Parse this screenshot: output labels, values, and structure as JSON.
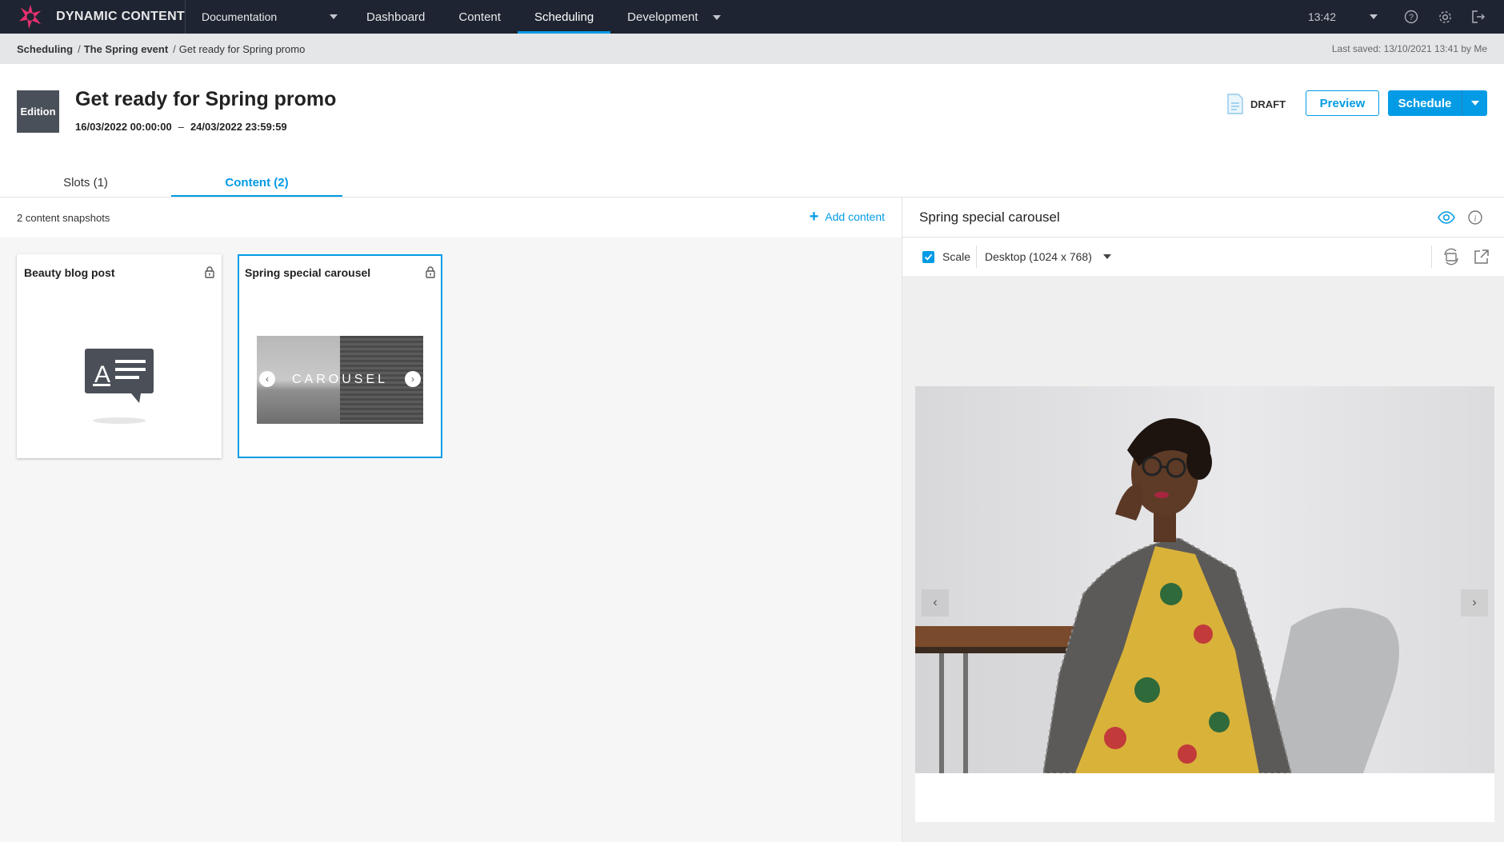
{
  "app": {
    "brand": "DYNAMIC CONTENT",
    "hub": "Documentation",
    "nav": [
      {
        "label": "Dashboard"
      },
      {
        "label": "Content"
      },
      {
        "label": "Scheduling",
        "active": true
      },
      {
        "label": "Development"
      }
    ],
    "clock": "13:42",
    "accent_color": "#039be5",
    "topbar_color": "#1e2431",
    "icons": [
      "help-icon",
      "settings-icon",
      "logout-icon"
    ]
  },
  "breadcrumb": {
    "items": [
      "Scheduling",
      "The Spring event",
      "Get ready for Spring promo"
    ],
    "last_saved": "Last saved: 13/10/2021 13:41 by Me"
  },
  "edition": {
    "badge": "Edition",
    "title": "Get ready for Spring promo",
    "start": "16/03/2022 00:00:00",
    "separator": "–",
    "end": "24/03/2022 23:59:59",
    "status": "DRAFT",
    "preview_label": "Preview",
    "schedule_label": "Schedule"
  },
  "tabs": [
    {
      "label": "Slots (1)",
      "active": false
    },
    {
      "label": "Content (2)",
      "active": true
    }
  ],
  "content_panel": {
    "count_label": "2 content snapshots",
    "add_label": "Add content",
    "cards": [
      {
        "title": "Beauty blog post",
        "locked": true,
        "selected": false,
        "thumbnail": "blog-post-icon"
      },
      {
        "title": "Spring special carousel",
        "locked": true,
        "selected": true,
        "thumbnail": "carousel-thumbnail",
        "thumbnail_text": "CAROUSEL"
      }
    ]
  },
  "preview": {
    "title": "Spring special carousel",
    "scale_label": "Scale",
    "scale_checked": true,
    "device": "Desktop (1024 x 768)"
  }
}
